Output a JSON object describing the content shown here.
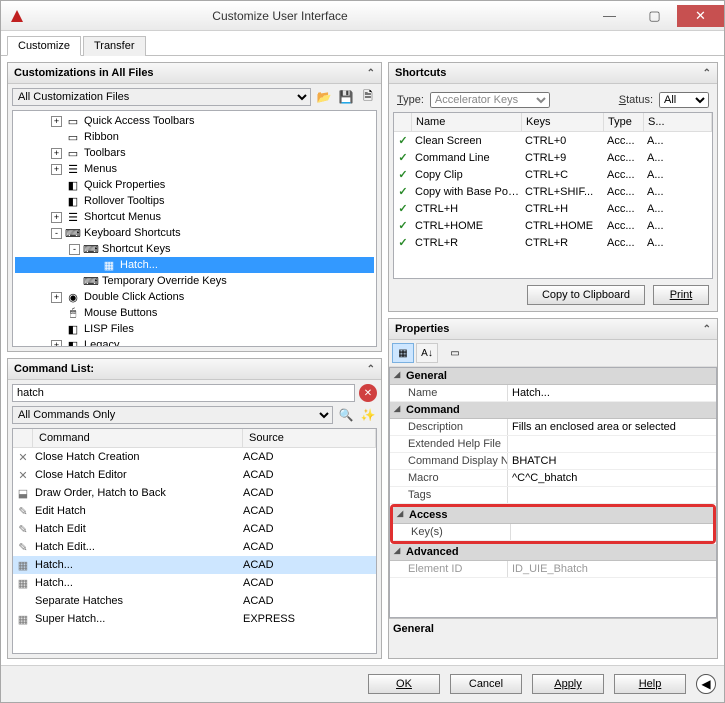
{
  "window": {
    "title": "Customize User Interface"
  },
  "tabs": {
    "customize": "Customize",
    "transfer": "Transfer"
  },
  "customizations": {
    "title": "Customizations in All Files",
    "filter": "All Customization Files",
    "tree": [
      {
        "indent": 2,
        "exp": "+",
        "icon": "▭",
        "label": "Quick Access Toolbars"
      },
      {
        "indent": 2,
        "exp": "",
        "icon": "▭",
        "label": "Ribbon"
      },
      {
        "indent": 2,
        "exp": "+",
        "icon": "▭",
        "label": "Toolbars"
      },
      {
        "indent": 2,
        "exp": "+",
        "icon": "☰",
        "label": "Menus"
      },
      {
        "indent": 2,
        "exp": "",
        "icon": "◧",
        "label": "Quick Properties"
      },
      {
        "indent": 2,
        "exp": "",
        "icon": "◧",
        "label": "Rollover Tooltips"
      },
      {
        "indent": 2,
        "exp": "+",
        "icon": "☰",
        "label": "Shortcut Menus"
      },
      {
        "indent": 2,
        "exp": "-",
        "icon": "⌨",
        "label": "Keyboard Shortcuts"
      },
      {
        "indent": 3,
        "exp": "-",
        "icon": "⌨",
        "label": "Shortcut Keys"
      },
      {
        "indent": 4,
        "exp": "",
        "icon": "▦",
        "label": "Hatch...",
        "sel": true
      },
      {
        "indent": 3,
        "exp": "",
        "icon": "⌨",
        "label": "Temporary Override Keys"
      },
      {
        "indent": 2,
        "exp": "+",
        "icon": "◉",
        "label": "Double Click Actions"
      },
      {
        "indent": 2,
        "exp": "",
        "icon": "🖱",
        "label": "Mouse Buttons"
      },
      {
        "indent": 2,
        "exp": "",
        "icon": "◧",
        "label": "LISP Files"
      },
      {
        "indent": 2,
        "exp": "+",
        "icon": "◧",
        "label": "Legacy"
      }
    ]
  },
  "commandlist": {
    "title": "Command List:",
    "search": "hatch",
    "filter": "All Commands Only",
    "headers": {
      "command": "Command",
      "source": "Source"
    },
    "rows": [
      {
        "icon": "✕",
        "cmd": "Close Hatch Creation",
        "src": "ACAD"
      },
      {
        "icon": "✕",
        "cmd": "Close Hatch Editor",
        "src": "ACAD"
      },
      {
        "icon": "⬓",
        "cmd": "Draw Order, Hatch to Back",
        "src": "ACAD"
      },
      {
        "icon": "✎",
        "cmd": "Edit Hatch",
        "src": "ACAD"
      },
      {
        "icon": "✎",
        "cmd": "Hatch Edit",
        "src": "ACAD"
      },
      {
        "icon": "✎",
        "cmd": "Hatch Edit...",
        "src": "ACAD"
      },
      {
        "icon": "▦",
        "cmd": "Hatch...",
        "src": "ACAD",
        "sel": true
      },
      {
        "icon": "▦",
        "cmd": "Hatch...",
        "src": "ACAD"
      },
      {
        "icon": " ",
        "cmd": "Separate Hatches",
        "src": "ACAD"
      },
      {
        "icon": "▦",
        "cmd": "Super Hatch...",
        "src": "EXPRESS"
      }
    ]
  },
  "shortcuts": {
    "title": "Shortcuts",
    "type_label": "Type:",
    "type_value": "Accelerator Keys",
    "status_label": "Status:",
    "status_value": "All",
    "headers": {
      "name": "Name",
      "keys": "Keys",
      "type": "Type",
      "source": "S..."
    },
    "rows": [
      {
        "name": "Clean Screen",
        "keys": "CTRL+0",
        "type": "Acc...",
        "src": "A..."
      },
      {
        "name": "Command Line",
        "keys": "CTRL+9",
        "type": "Acc...",
        "src": "A..."
      },
      {
        "name": "Copy Clip",
        "keys": "CTRL+C",
        "type": "Acc...",
        "src": "A..."
      },
      {
        "name": "Copy with Base Point",
        "keys": "CTRL+SHIF...",
        "type": "Acc...",
        "src": "A..."
      },
      {
        "name": "CTRL+H",
        "keys": "CTRL+H",
        "type": "Acc...",
        "src": "A..."
      },
      {
        "name": "CTRL+HOME",
        "keys": "CTRL+HOME",
        "type": "Acc...",
        "src": "A..."
      },
      {
        "name": "CTRL+R",
        "keys": "CTRL+R",
        "type": "Acc...",
        "src": "A..."
      }
    ],
    "copy_btn": "Copy to Clipboard",
    "print_btn": "Print"
  },
  "properties": {
    "title": "Properties",
    "cats": {
      "general": "General",
      "command": "Command",
      "access": "Access",
      "advanced": "Advanced"
    },
    "rows": {
      "name_l": "Name",
      "name_v": "Hatch...",
      "desc_l": "Description",
      "desc_v": "Fills an enclosed area or selected",
      "ehf_l": "Extended Help File",
      "ehf_v": "",
      "cdn_l": "Command Display Name",
      "cdn_v": "BHATCH",
      "macro_l": "Macro",
      "macro_v": "^C^C_bhatch",
      "tags_l": "Tags",
      "tags_v": "",
      "keys_l": "Key(s)",
      "keys_v": "",
      "eid_l": "Element ID",
      "eid_v": "ID_UIE_Bhatch"
    },
    "desc_title": "General"
  },
  "footer": {
    "ok": "OK",
    "cancel": "Cancel",
    "apply": "Apply",
    "help": "Help"
  }
}
